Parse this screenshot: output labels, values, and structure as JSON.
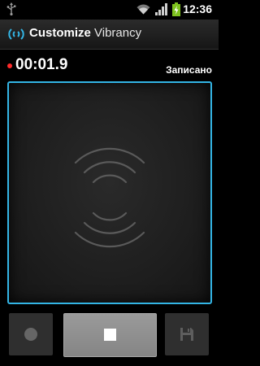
{
  "status_bar": {
    "time": "12:36",
    "icons": [
      "usb-icon",
      "wifi-icon",
      "signal-icon",
      "battery-charging-icon"
    ]
  },
  "title_bar": {
    "title_bold": "Customize",
    "title_rest": " Vibrancy",
    "icon": "vibration-icon"
  },
  "recorder": {
    "timer": "00:01.9",
    "status": "Записано",
    "recording_indicator_color": "#ff2a2a"
  },
  "pad": {
    "border_color": "#33b5e5",
    "icon": "vibration-waves-icon"
  },
  "controls": {
    "record_icon": "record-icon",
    "stop_icon": "stop-icon",
    "save_icon": "save-icon"
  }
}
